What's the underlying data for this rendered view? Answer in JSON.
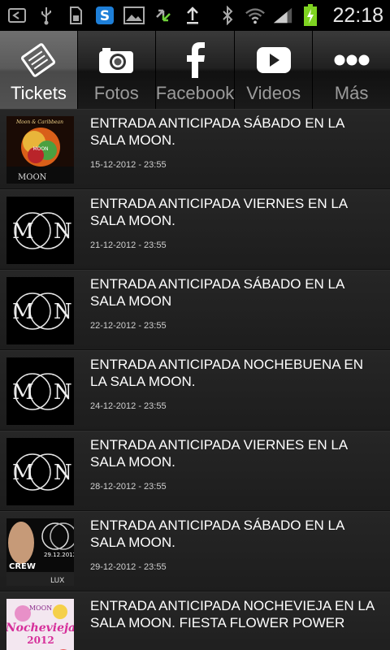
{
  "status_bar": {
    "time": "22:18",
    "icons": [
      "back-icon",
      "usb-icon",
      "sd-card-icon",
      "s-app-icon",
      "gallery-icon",
      "sync-icon",
      "upload-icon",
      "bluetooth-icon",
      "wifi-icon",
      "signal-icon",
      "battery-charging-icon"
    ]
  },
  "tabs": [
    {
      "label": "Tickets",
      "icon": "ticket-icon",
      "active": true
    },
    {
      "label": "Fotos",
      "icon": "camera-icon",
      "active": false
    },
    {
      "label": "Facebook",
      "icon": "facebook-icon",
      "active": false
    },
    {
      "label": "Videos",
      "icon": "play-icon",
      "active": false
    },
    {
      "label": "Más",
      "icon": "more-icon",
      "active": false
    }
  ],
  "items": [
    {
      "title": "ENTRADA ANTICIPADA SÁBADO EN LA SALA MOON.",
      "date": "15-12-2012 - 23:55",
      "thumb": "poster-moon-caribbean"
    },
    {
      "title": "ENTRADA ANTICIPADA VIERNES EN LA SALA MOON.",
      "date": "21-12-2012 - 23:55",
      "thumb": "moon-logo"
    },
    {
      "title": "ENTRADA ANTICIPADA SÁBADO EN LA SALA MOON",
      "date": "22-12-2012 - 23:55",
      "thumb": "moon-logo"
    },
    {
      "title": "ENTRADA ANTICIPADA NOCHEBUENA EN LA SALA MOON.",
      "date": "24-12-2012 - 23:55",
      "thumb": "moon-logo"
    },
    {
      "title": "ENTRADA ANTICIPADA VIERNES EN LA SALA MOON.",
      "date": "28-12-2012 - 23:55",
      "thumb": "moon-logo"
    },
    {
      "title": "ENTRADA ANTICIPADA SÁBADO EN LA SALA MOON.",
      "date": "29-12-2012 - 23:55",
      "thumb": "poster-crew"
    },
    {
      "title": "ENTRADA ANTICIPADA NOCHEVIEJA EN LA SALA MOON.  FIESTA FLOWER POWER",
      "date": "",
      "thumb": "poster-nochevieja"
    }
  ],
  "thumb_text": {
    "moon": "MOON",
    "poster1_heading": "Moon & Caribbean",
    "poster1_sub": "MOON",
    "poster2_date": "29.12.2012",
    "poster2_brand": "CREW",
    "poster2_lux": "LUX",
    "poster3_heading": "MOON",
    "poster3_title": "Nochevieja",
    "poster3_year": "2012"
  },
  "colors": {
    "active_tab": "#5a5a5a",
    "inactive_tab_label": "#9b9b9b",
    "battery_green": "#7fd321"
  }
}
